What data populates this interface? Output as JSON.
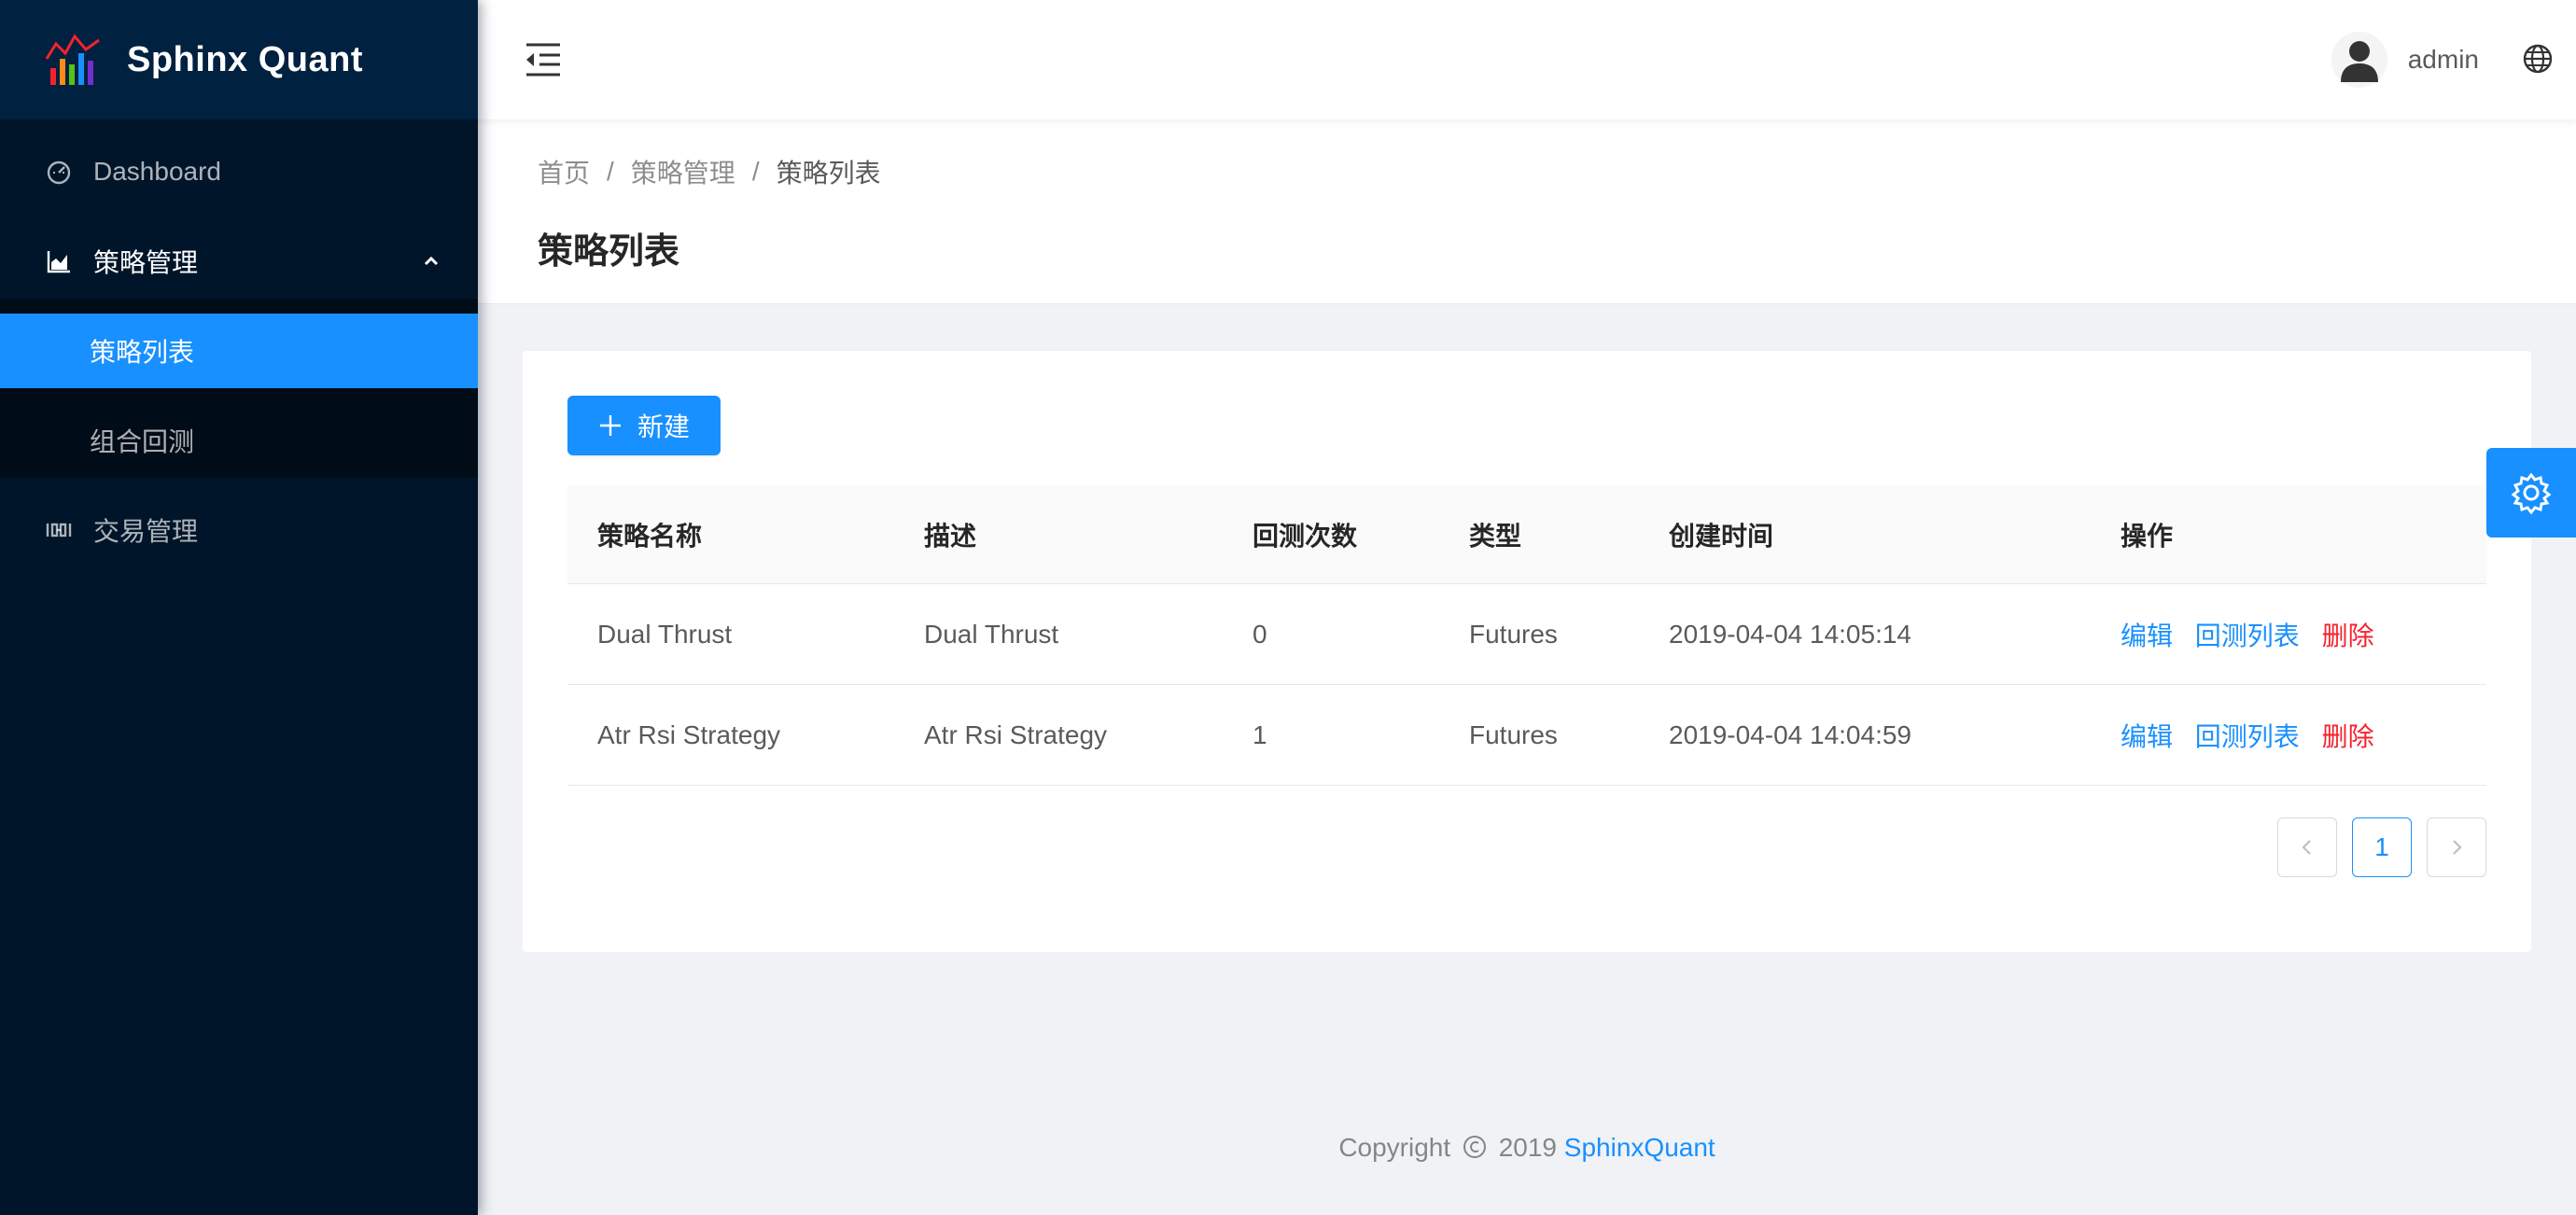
{
  "app": {
    "title": "Sphinx Quant",
    "logo_icon": "chart-logo-icon"
  },
  "sidebar": {
    "items": [
      {
        "label": "Dashboard",
        "icon": "dashboard-icon"
      },
      {
        "label": "策略管理",
        "icon": "area-chart-icon",
        "open": true,
        "children": [
          {
            "label": "策略列表",
            "active": true
          },
          {
            "label": "组合回测",
            "active": false
          }
        ]
      },
      {
        "label": "交易管理",
        "icon": "sliders-icon"
      }
    ]
  },
  "header": {
    "username": "admin",
    "icons": [
      "menu-fold-icon",
      "user-avatar-icon",
      "globe-icon"
    ]
  },
  "breadcrumb": [
    "首页",
    "策略管理",
    "策略列表"
  ],
  "page": {
    "title": "策略列表",
    "new_button": "新建"
  },
  "table": {
    "columns": [
      "策略名称",
      "描述",
      "回测次数",
      "类型",
      "创建时间",
      "操作"
    ],
    "rows": [
      {
        "name": "Dual Thrust",
        "desc": "Dual Thrust",
        "count": "0",
        "type": "Futures",
        "created": "2019-04-04 14:05:14"
      },
      {
        "name": "Atr Rsi Strategy",
        "desc": "Atr Rsi Strategy",
        "count": "1",
        "type": "Futures",
        "created": "2019-04-04 14:04:59"
      }
    ],
    "actions": {
      "edit": "编辑",
      "backtests": "回测列表",
      "delete": "删除"
    }
  },
  "pagination": {
    "current": "1"
  },
  "footer": {
    "prefix": "Copyright",
    "year": "2019",
    "brand": "SphinxQuant"
  },
  "colors": {
    "primary": "#1890ff",
    "sider": "#001529",
    "danger": "#f5222d"
  }
}
